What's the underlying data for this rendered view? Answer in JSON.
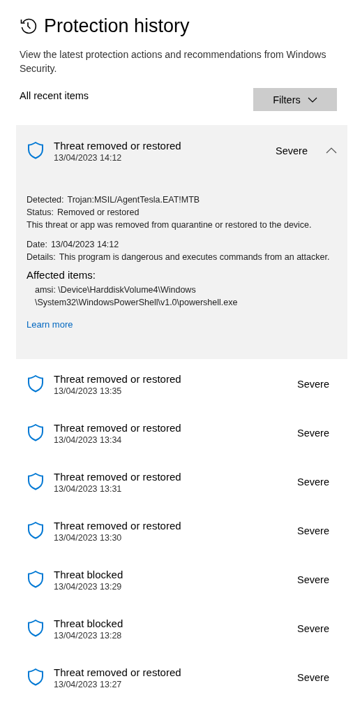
{
  "page": {
    "title": "Protection history",
    "description": "View the latest protection actions and recommendations from Windows Security.",
    "section_label": "All recent items",
    "filters_button": "Filters"
  },
  "items": [
    {
      "title": "Threat removed or restored",
      "time": "13/04/2023 14:12",
      "severity": "Severe",
      "expanded": true,
      "details": {
        "fields": [
          {
            "label": "Detected:",
            "value": "Trojan:MSIL/AgentTesla.EAT!MTB"
          },
          {
            "label": "Status:",
            "value": "Removed or restored"
          }
        ],
        "note": "This threat or app was removed from quarantine or restored to the device.",
        "fields2": [
          {
            "label": "Date:",
            "value": "13/04/2023 14:12"
          },
          {
            "label": "Details:",
            "value": "This program is dangerous and executes commands from an attacker."
          }
        ],
        "affected_heading": "Affected items:",
        "affected": [
          "amsi: \\Device\\HarddiskVolume4\\Windows \\System32\\WindowsPowerShell\\v1.0\\powershell.exe"
        ],
        "link": "Learn more"
      }
    },
    {
      "title": "Threat removed or restored",
      "time": "13/04/2023 13:35",
      "severity": "Severe",
      "expanded": false
    },
    {
      "title": "Threat removed or restored",
      "time": "13/04/2023 13:34",
      "severity": "Severe",
      "expanded": false
    },
    {
      "title": "Threat removed or restored",
      "time": "13/04/2023 13:31",
      "severity": "Severe",
      "expanded": false
    },
    {
      "title": "Threat removed or restored",
      "time": "13/04/2023 13:30",
      "severity": "Severe",
      "expanded": false
    },
    {
      "title": "Threat blocked",
      "time": "13/04/2023 13:29",
      "severity": "Severe",
      "expanded": false
    },
    {
      "title": "Threat blocked",
      "time": "13/04/2023 13:28",
      "severity": "Severe",
      "expanded": false
    },
    {
      "title": "Threat removed or restored",
      "time": "13/04/2023 13:27",
      "severity": "Severe",
      "expanded": false
    }
  ]
}
